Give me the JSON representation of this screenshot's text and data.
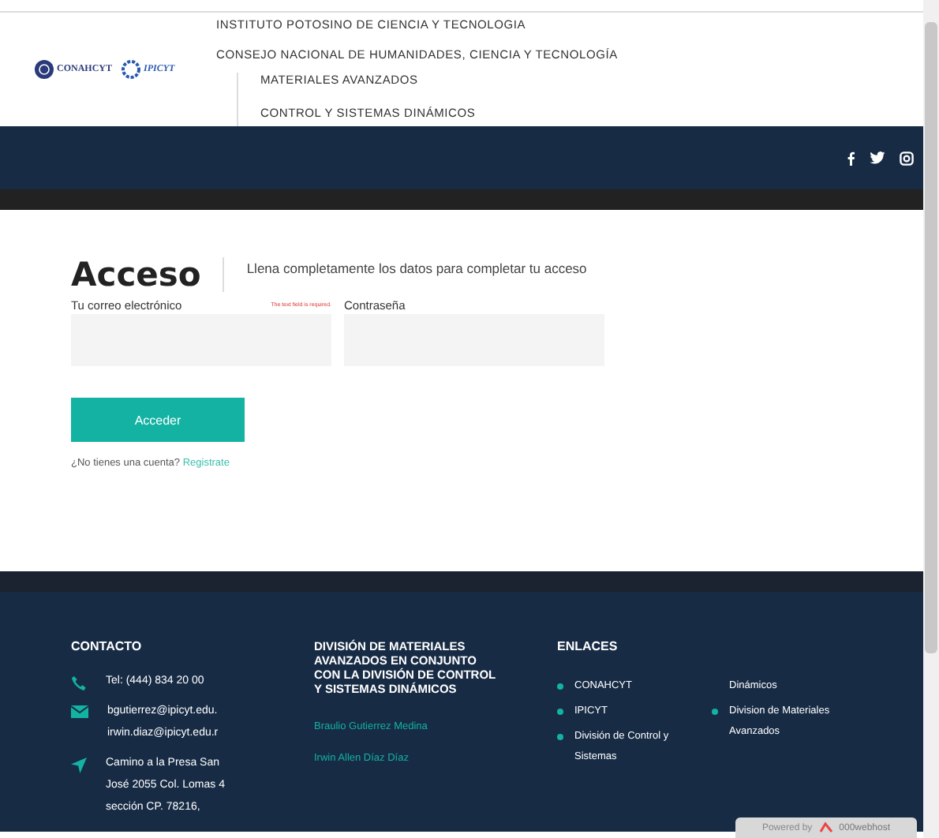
{
  "header": {
    "logos": [
      "CONAHCYT",
      "IPICYT"
    ],
    "lines": [
      "INSTITUTO POTOSINO DE CIENCIA Y TECNOLOGIA",
      "CONSEJO NACIONAL DE HUMANIDADES, CIENCIA Y TECNOLOGÍA"
    ],
    "sub_lines": [
      "MATERIALES AVANZADOS",
      "CONTROL Y SISTEMAS DINÁMICOS"
    ]
  },
  "social": [
    {
      "kind": "facebook"
    },
    {
      "kind": "twitter"
    },
    {
      "kind": "instagram"
    }
  ],
  "login": {
    "title": "Acceso",
    "subtitle": "Llena completamente los datos para completar tu acceso",
    "email_label": "Tu correo electrónico",
    "error": "The text field is required.",
    "password_label": "Contraseña",
    "button": "Acceder",
    "prompt": "¿No tienes una cuenta?",
    "link": "Registrate"
  },
  "footer": {
    "contact": {
      "title": "CONTACTO",
      "items": [
        {
          "kind": "phone",
          "lines": [
            "Tel: (444) 834 20 00"
          ]
        },
        {
          "kind": "mail",
          "lines": [
            "bgutierrez@ipicyt.edu.",
            "irwin.diaz@ipicyt.edu.r"
          ]
        },
        {
          "kind": "location",
          "lines": [
            "Camino a la Presa San",
            "José 2055 Col. Lomas 4",
            "sección CP. 78216,"
          ]
        }
      ]
    },
    "division": {
      "title": "DIVISIÓN DE MATERIALES AVANZADOS EN CONJUNTO CON LA DIVISIÓN DE CONTROL Y SISTEMAS DINÁMICOS",
      "names": [
        "Braulio Gutierrez Medina",
        "Irwin Allen Díaz Díaz"
      ]
    },
    "links": {
      "title": "ENLACES",
      "columns": [
        [
          {
            "text": "CONAHCYT",
            "bullet": true
          },
          {
            "text": "IPICYT",
            "bullet": true
          },
          {
            "text": "División de Control y Sistemas",
            "bullet": true
          }
        ],
        [
          {
            "text": "Dinámicos",
            "bullet": false
          },
          {
            "text": "Division de Materiales Avanzados",
            "bullet": true
          }
        ]
      ]
    }
  },
  "badge": {
    "prefix": "Powered by",
    "brand": "000webhost"
  }
}
